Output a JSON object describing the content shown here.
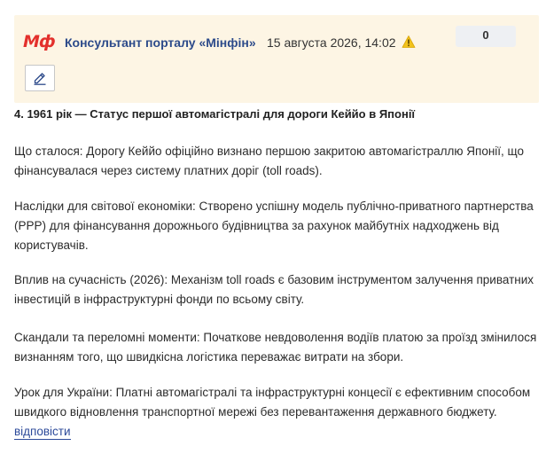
{
  "header": {
    "logo_text": "Мф",
    "author": "Консультант порталу «Мінфін»",
    "date": "15 августа 2026, 14:02",
    "counter": "0",
    "brand_color": "#e3302c",
    "author_color": "#2c4a8a",
    "background_color": "#fdf5e4",
    "warning_icon": "warning-triangle-icon",
    "edit_icon": "pencil-icon"
  },
  "post": {
    "title": "4. 1961 рік — Статус першої автомагістралі для дороги Кеййо в Японії",
    "paragraphs": [
      "Що сталося: Дорогу Кеййо офіційно визнано першою закритою автомагістраллю Японії, що фінансувалася через систему платних доріг (toll roads).",
      "Наслідки для світової економіки: Створено успішну модель публічно-приватного партнерства (PPP) для фінансування дорожнього будівництва за рахунок майбутніх надходжень від користувачів.",
      "Вплив на сучасність (2026): Механізм toll roads є базовим інструментом залучення приватних інвестицій в інфраструктурні фонди по всьому світу.",
      "Скандали та переломні моменти: Початкове невдоволення водіїв платою за проїзд змінилося визнанням того, що швидкісна логістика переважає витрати на збори.",
      "Урок для України: Платні автомагістралі та інфраструктурні концесії є ефективним способом швидкого відновлення транспортної мережі без перевантаження державного бюджету."
    ],
    "reply_label": "відповісти"
  }
}
